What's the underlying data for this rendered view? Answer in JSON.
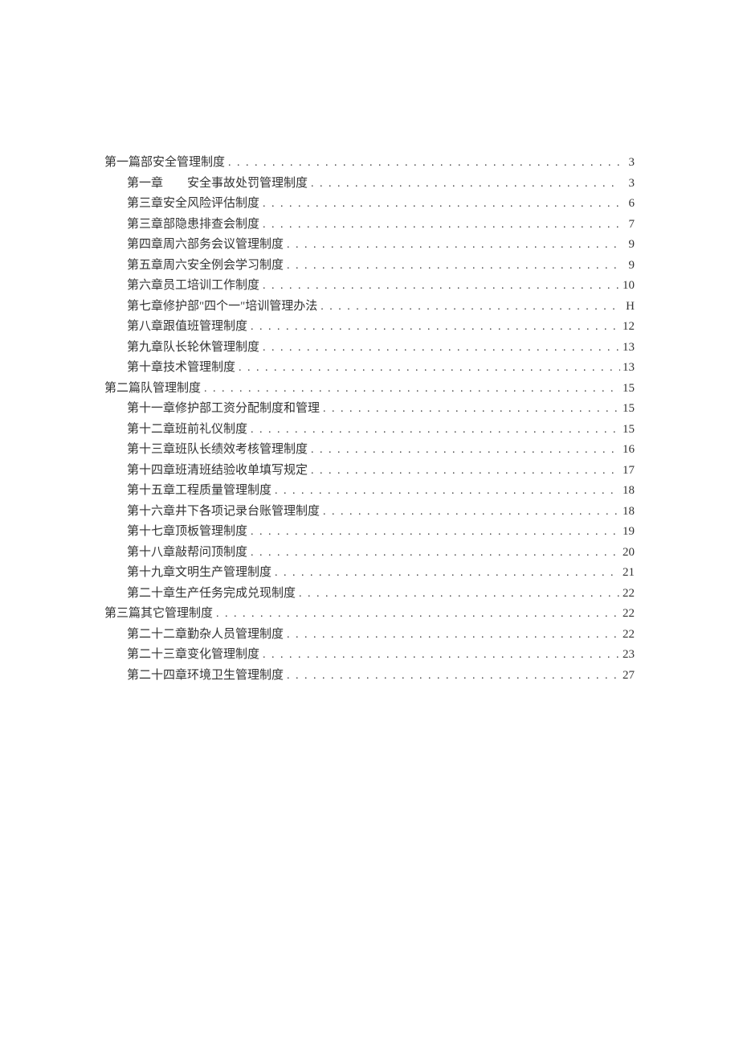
{
  "toc": [
    {
      "level": 0,
      "title": "第一篇部安全管理制度",
      "page": "3"
    },
    {
      "level": 1,
      "title": "第一章",
      "spacer": true,
      "title2": "安全事故处罚管理制度",
      "page": "3"
    },
    {
      "level": 1,
      "title": "第三章安全风险评估制度",
      "page": "6"
    },
    {
      "level": 1,
      "title": "第三章部隐患排查会制度",
      "page": "7"
    },
    {
      "level": 1,
      "title": "第四章周六部务会议管理制度",
      "page": "9"
    },
    {
      "level": 1,
      "title": "第五章周六安全例会学习制度",
      "page": "9"
    },
    {
      "level": 1,
      "title": "第六章员工培训工作制度",
      "page": "10"
    },
    {
      "level": 1,
      "title": "第七章修护部\"四个一\"培训管理办法",
      "page": "H"
    },
    {
      "level": 1,
      "title": "第八章跟值班管理制度",
      "page": "12"
    },
    {
      "level": 1,
      "title": "第九章队长轮休管理制度",
      "page": "13"
    },
    {
      "level": 1,
      "title": "第十章技术管理制度",
      "page": "13"
    },
    {
      "level": 0,
      "title": "第二篇队管理制度",
      "page": "15"
    },
    {
      "level": 1,
      "title": "第十一章修护部工资分配制度和管理",
      "page": "15"
    },
    {
      "level": 1,
      "title": "第十二章班前礼仪制度",
      "page": "15"
    },
    {
      "level": 1,
      "title": "第十三章班队长绩效考核管理制度",
      "page": "16"
    },
    {
      "level": 1,
      "title": "第十四章班清班结验收单填写规定",
      "page": "17"
    },
    {
      "level": 1,
      "title": "第十五章工程质量管理制度",
      "page": "18"
    },
    {
      "level": 1,
      "title": "第十六章井下各项记录台账管理制度",
      "page": "18"
    },
    {
      "level": 1,
      "title": "第十七章顶板管理制度",
      "page": "19"
    },
    {
      "level": 1,
      "title": "第十八章敲帮问顶制度",
      "page": "20"
    },
    {
      "level": 1,
      "title": "第十九章文明生产管理制度",
      "page": "21"
    },
    {
      "level": 1,
      "title": "第二十章生产任务完成兑现制度",
      "page": "22"
    },
    {
      "level": 0,
      "title": "第三篇其它管理制度",
      "page": "22"
    },
    {
      "level": 1,
      "title": "第二十二章勤杂人员管理制度",
      "page": "22"
    },
    {
      "level": 1,
      "title": "第二十三章变化管理制度",
      "page": "23"
    },
    {
      "level": 1,
      "title": "第二十四章环境卫生管理制度",
      "page": "27"
    }
  ],
  "dots": ". . . . . . . . . . . . . . . . . . . . . . . . . . . . . . . . . . . . . . . . . . . . . . . . . . . . . . . . . . . . . . . . . . . . . . . . . . . . . . . . . . . . . . . . . . . . . . . . . . . ."
}
